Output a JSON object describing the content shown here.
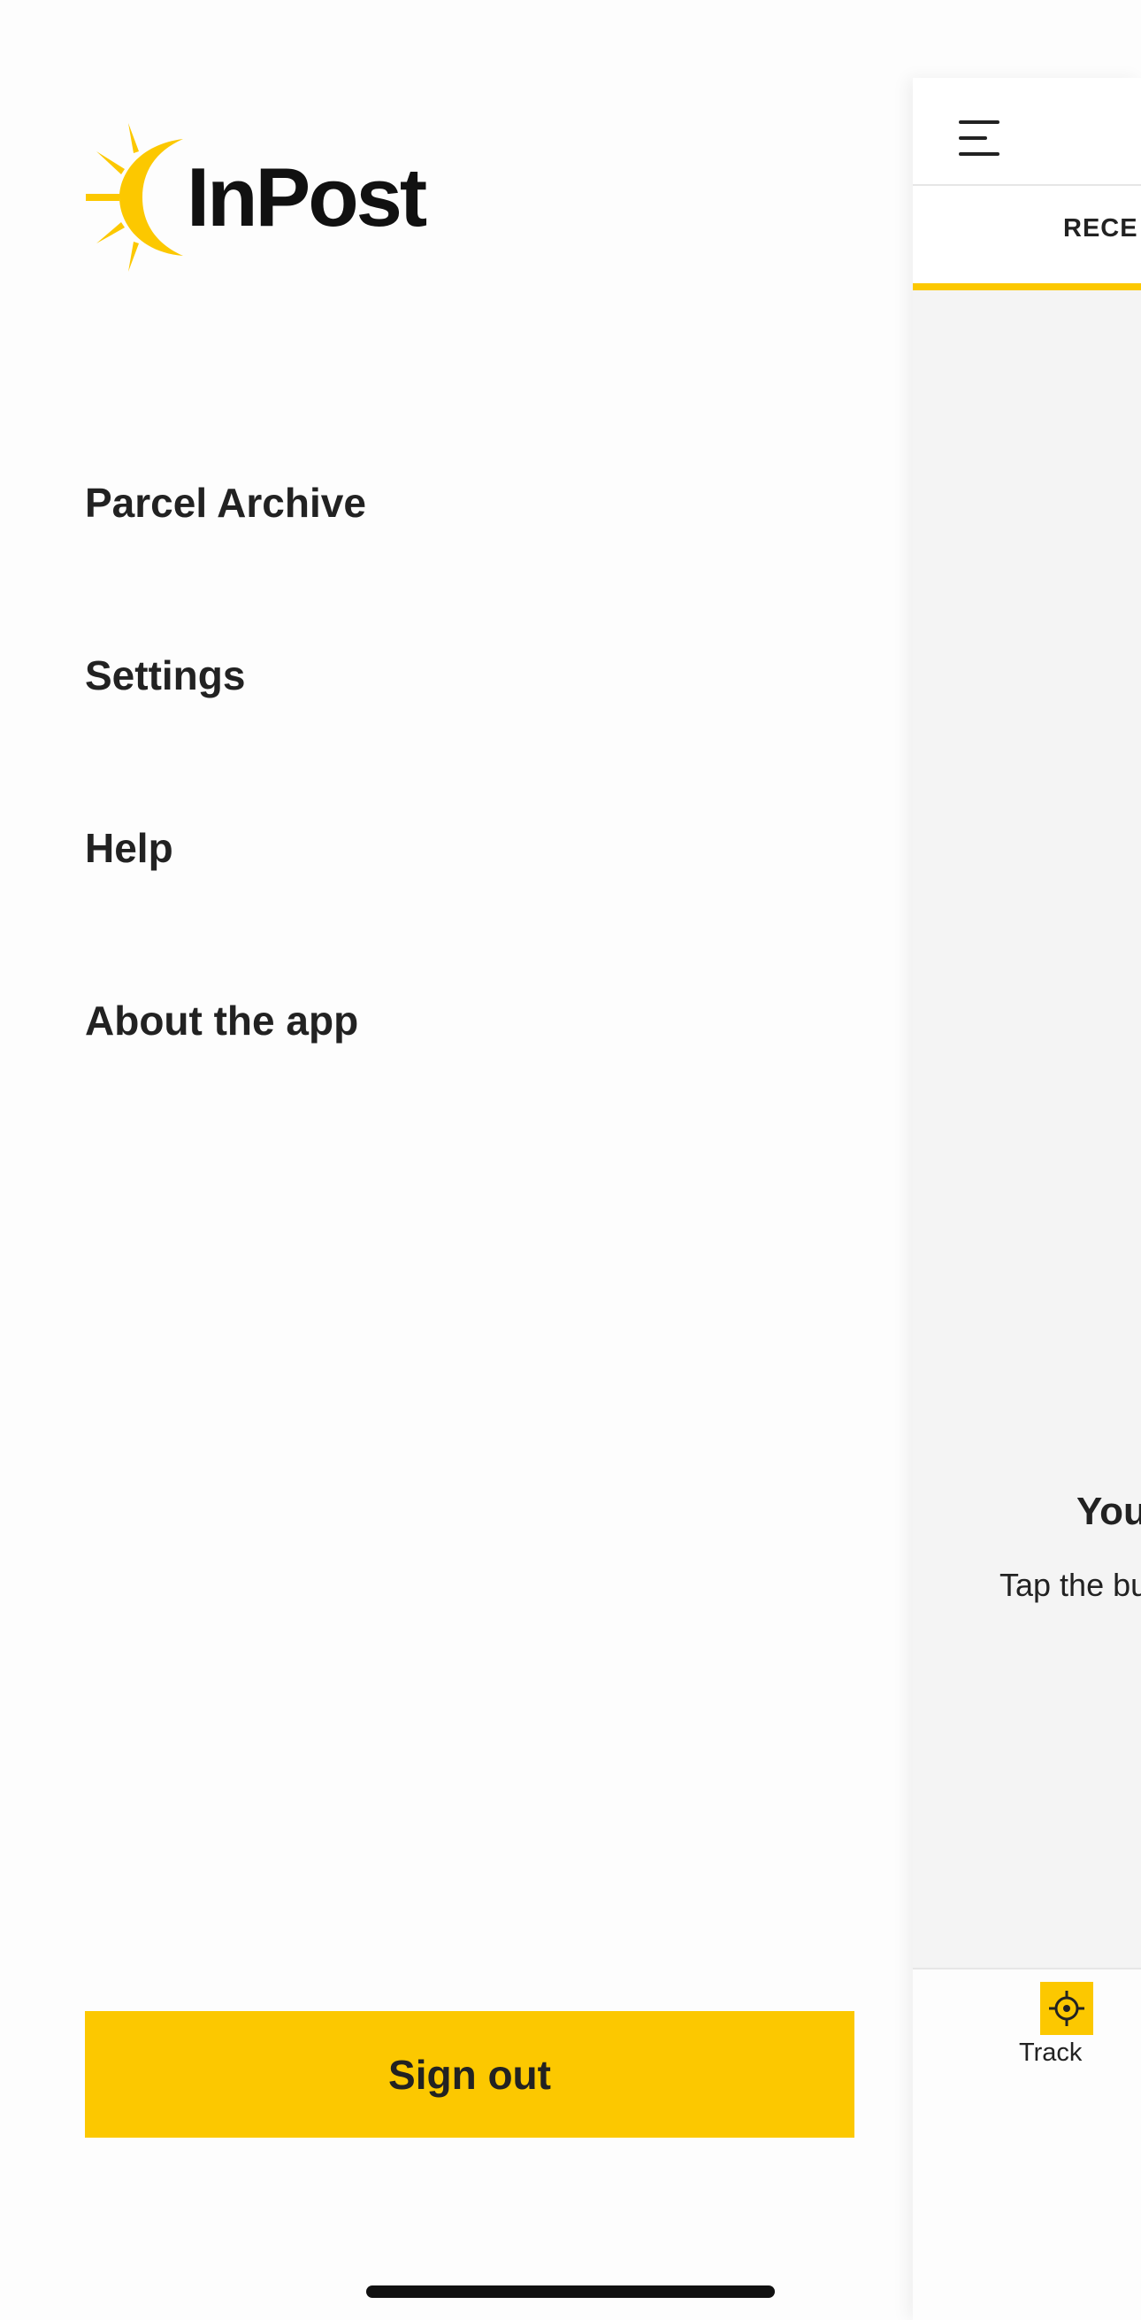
{
  "brand": {
    "logo_text": "InPost",
    "accent_color": "#fcc800"
  },
  "menu": {
    "items": [
      {
        "label": "Parcel Archive"
      },
      {
        "label": "Settings"
      },
      {
        "label": "Help"
      },
      {
        "label": "About the app"
      }
    ],
    "signout_label": "Sign out"
  },
  "main": {
    "menu_icon": "hamburger-menu-icon",
    "tab_label": "RECE",
    "empty_title": "You",
    "empty_subtitle": "Tap the bu",
    "bottom_nav": {
      "track_label": "Track",
      "track_icon": "crosshair-icon"
    }
  }
}
